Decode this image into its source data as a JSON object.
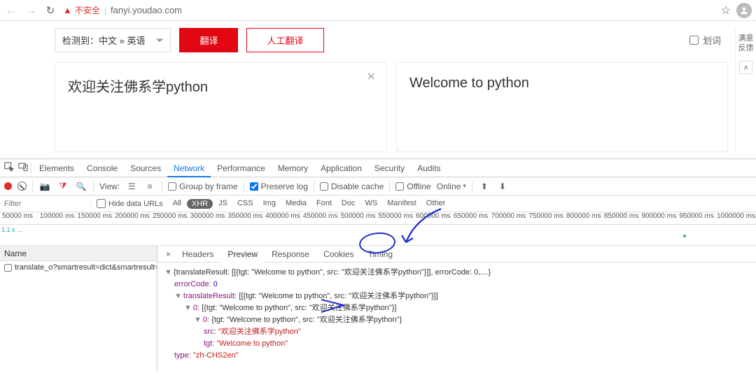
{
  "browser": {
    "insecure_label": "不安全",
    "url": "fanyi.youdao.com"
  },
  "page": {
    "lang_detect": "检测到：中文 » 英语",
    "translate_btn": "翻译",
    "human_btn": "人工翻译",
    "huaci": "划词",
    "input_text": "欢迎关注佛系学python",
    "output_text": "Welcome to python",
    "sidebar_line1": "满意",
    "sidebar_line2": "反馈"
  },
  "devtools": {
    "tabs": [
      "Elements",
      "Console",
      "Sources",
      "Network",
      "Performance",
      "Memory",
      "Application",
      "Security",
      "Audits"
    ],
    "active_tab": "Network",
    "toolbar": {
      "view": "View:",
      "group_by_frame": "Group by frame",
      "preserve_log": "Preserve log",
      "disable_cache": "Disable cache",
      "offline": "Offline",
      "online": "Online"
    },
    "filter": {
      "placeholder": "Filter",
      "hide_data_urls": "Hide data URLs",
      "chips": [
        "All",
        "XHR",
        "JS",
        "CSS",
        "Img",
        "Media",
        "Font",
        "Doc",
        "WS",
        "Manifest",
        "Other"
      ]
    },
    "timeline": [
      "50000 ms",
      "100000 ms",
      "150000 ms",
      "200000 ms",
      "250000 ms",
      "300000 ms",
      "350000 ms",
      "400000 ms",
      "450000 ms",
      "500000 ms",
      "550000 ms",
      "600000 ms",
      "650000 ms",
      "700000 ms",
      "750000 ms",
      "800000 ms",
      "850000 ms",
      "900000 ms",
      "950000 ms",
      "1000000 ms"
    ],
    "timeline_rowlabel": "1.1 s  …",
    "requests": {
      "header": "Name",
      "items": [
        "translate_o?smartresult=dict&smartresult=r…"
      ]
    },
    "detail_tabs": [
      "Headers",
      "Preview",
      "Response",
      "Cookies",
      "Timing"
    ],
    "detail_active": "Preview",
    "preview": {
      "line0": "{translateResult: [[{tgt: \"Welcome to python\", src: \"欢迎关注佛系学python\"}]], errorCode: 0,…}",
      "errorCode_key": "errorCode:",
      "errorCode_val": "0",
      "tr_key": "translateResult:",
      "tr_val": "[[{tgt: \"Welcome to python\", src: \"欢迎关注佛系学python\"}]]",
      "l0_key": "0:",
      "l0_val": "[{tgt: \"Welcome to python\", src: \"欢迎关注佛系学python\"}]",
      "l00_key": "0:",
      "l00_val": "{tgt: \"Welcome to python\", src: \"欢迎关注佛系学python\"}",
      "src_key": "src:",
      "src_val": "\"欢迎关注佛系学python\"",
      "tgt_key": "tgt:",
      "tgt_val": "\"Welcome to python\"",
      "type_key": "type:",
      "type_val": "\"zh-CHS2en\""
    }
  },
  "response_data": {
    "translateResult": [
      [
        {
          "tgt": "Welcome to python",
          "src": "欢迎关注佛系学python"
        }
      ]
    ],
    "errorCode": 0,
    "type": "zh-CHS2en"
  }
}
